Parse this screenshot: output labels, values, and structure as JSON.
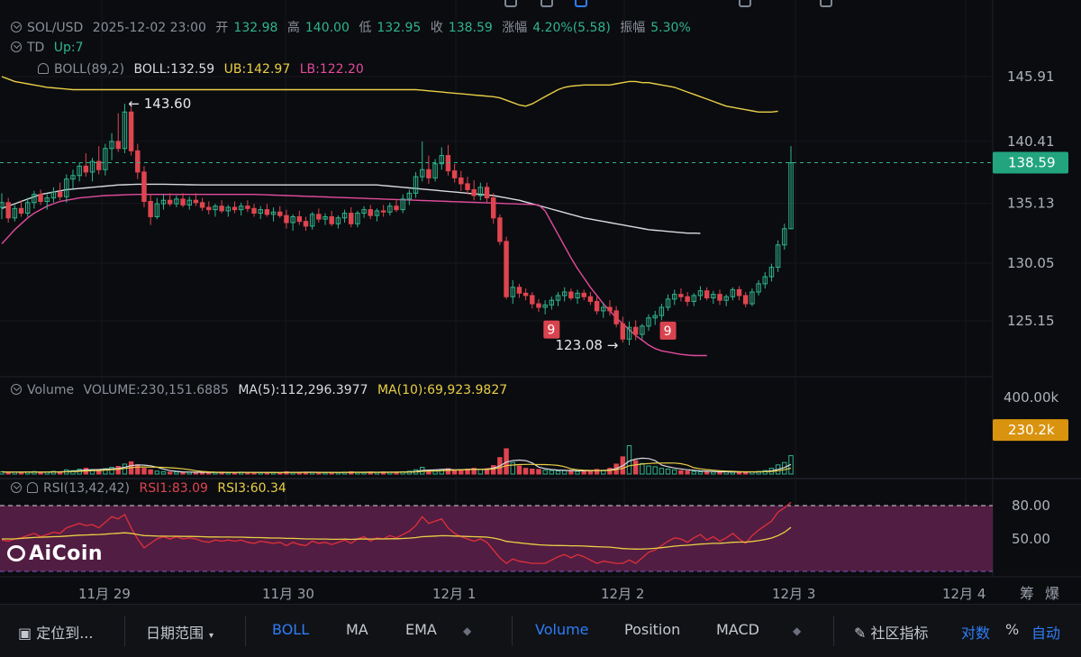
{
  "header": {
    "symbol": "SOL/USD",
    "datetime": "2025-12-02 23:00",
    "open_label": "开",
    "open": "132.98",
    "high_label": "高",
    "high": "140.00",
    "low_label": "低",
    "low": "132.95",
    "close_label": "收",
    "close": "138.59",
    "change_label": "涨幅",
    "change": "4.20%(5.58)",
    "amp_label": "振幅",
    "amp": "5.30%"
  },
  "indicators": {
    "td_label": "TD",
    "td_value": "Up:7",
    "boll_label": "BOLL(89,2)",
    "boll_mid": "BOLL:132.59",
    "boll_ub": "UB:142.97",
    "boll_lb": "LB:122.20",
    "vol_label": "Volume",
    "vol_value": "VOLUME:230,151.6885",
    "vol_ma5": "MA(5):112,296.3977",
    "vol_ma10": "MA(10):69,923.9827",
    "rsi_label": "RSI(13,42,42)",
    "rsi1": "RSI1:83.09",
    "rsi3": "RSI3:60.34"
  },
  "toolbar": {
    "locate": "定位到...",
    "date_range": "日期范围",
    "boll": "BOLL",
    "ma": "MA",
    "ema": "EMA",
    "volume": "Volume",
    "position": "Position",
    "macd": "MACD",
    "community": "社区指标",
    "log": "对数",
    "percent": "%",
    "auto": "自动"
  },
  "logo": "AiCoin",
  "colors": {
    "up": "#2fb58d",
    "down": "#e0454f",
    "mid": "#d7dbe0",
    "ub": "#e8cf46",
    "lb": "#e24c9c",
    "accent": "#2f7df6"
  },
  "chart_data": {
    "type": "candlestick",
    "price_axis_ticks": [
      145.91,
      140.41,
      135.13,
      130.05,
      125.15
    ],
    "current_price": 138.59,
    "volume_axis_ticks": [
      "400.00k"
    ],
    "volume_current": "230.2k",
    "rsi_axis_ticks": [
      80.0,
      50.0
    ],
    "x_ticks": [
      "11月 29",
      "11月 30",
      "12月 1",
      "12月 2",
      "12月 3",
      "12月 4"
    ],
    "x_extra": [
      "筹",
      "爆"
    ],
    "annotations": {
      "high": "143.60",
      "low": "123.08",
      "td_marks": [
        "9",
        "9"
      ]
    },
    "ohlc": [
      [
        134.8,
        136.0,
        133.8,
        135.2
      ],
      [
        135.2,
        135.6,
        133.5,
        133.9
      ],
      [
        133.9,
        135.0,
        133.6,
        134.7
      ],
      [
        134.7,
        135.4,
        134.0,
        134.3
      ],
      [
        134.3,
        135.6,
        134.0,
        135.2
      ],
      [
        135.2,
        136.2,
        134.7,
        135.9
      ],
      [
        135.9,
        136.3,
        135.0,
        135.3
      ],
      [
        135.3,
        135.9,
        134.6,
        135.6
      ],
      [
        135.6,
        136.5,
        135.2,
        136.1
      ],
      [
        136.1,
        136.9,
        135.4,
        135.7
      ],
      [
        135.7,
        137.6,
        135.2,
        137.2
      ],
      [
        137.2,
        138.0,
        136.4,
        137.5
      ],
      [
        137.5,
        138.6,
        137.0,
        138.3
      ],
      [
        138.3,
        139.4,
        137.4,
        137.8
      ],
      [
        137.8,
        139.0,
        137.0,
        138.7
      ],
      [
        138.7,
        140.0,
        137.6,
        138.0
      ],
      [
        138.0,
        140.2,
        137.5,
        139.8
      ],
      [
        139.8,
        141.1,
        138.8,
        140.4
      ],
      [
        140.4,
        142.8,
        139.5,
        139.8
      ],
      [
        139.8,
        143.6,
        139.4,
        142.9
      ],
      [
        142.9,
        143.3,
        139.2,
        139.6
      ],
      [
        139.6,
        140.2,
        137.2,
        137.8
      ],
      [
        137.8,
        138.3,
        134.8,
        135.3
      ],
      [
        135.3,
        135.9,
        133.3,
        134.0
      ],
      [
        134.0,
        135.6,
        133.8,
        135.1
      ],
      [
        135.1,
        135.9,
        134.6,
        135.4
      ],
      [
        135.4,
        136.0,
        134.9,
        135.1
      ],
      [
        135.1,
        135.8,
        134.8,
        135.5
      ],
      [
        135.5,
        136.0,
        134.8,
        135.0
      ],
      [
        135.0,
        135.7,
        134.6,
        135.4
      ],
      [
        135.4,
        136.0,
        134.9,
        135.2
      ],
      [
        135.2,
        135.6,
        134.5,
        134.8
      ],
      [
        134.8,
        135.3,
        134.2,
        134.6
      ],
      [
        134.6,
        135.1,
        134.0,
        134.9
      ],
      [
        134.9,
        135.4,
        134.3,
        134.5
      ],
      [
        134.5,
        135.0,
        134.0,
        134.8
      ],
      [
        134.8,
        135.3,
        134.3,
        134.6
      ],
      [
        134.6,
        135.2,
        134.1,
        134.9
      ],
      [
        134.9,
        135.4,
        134.4,
        134.7
      ],
      [
        134.7,
        135.1,
        134.0,
        134.3
      ],
      [
        134.3,
        134.9,
        133.8,
        134.6
      ],
      [
        134.6,
        135.1,
        134.0,
        134.2
      ],
      [
        134.2,
        134.8,
        133.6,
        134.4
      ],
      [
        134.4,
        134.9,
        133.9,
        134.1
      ],
      [
        134.1,
        134.6,
        133.0,
        133.5
      ],
      [
        133.5,
        134.2,
        132.8,
        134.0
      ],
      [
        134.0,
        134.5,
        133.3,
        133.6
      ],
      [
        133.6,
        134.0,
        132.8,
        133.2
      ],
      [
        133.2,
        134.4,
        132.9,
        134.2
      ],
      [
        134.2,
        134.7,
        133.5,
        133.8
      ],
      [
        133.8,
        134.3,
        133.3,
        134.0
      ],
      [
        134.0,
        134.5,
        133.2,
        133.4
      ],
      [
        133.4,
        134.1,
        133.0,
        133.9
      ],
      [
        133.9,
        134.6,
        133.5,
        134.3
      ],
      [
        134.3,
        134.8,
        133.1,
        133.4
      ],
      [
        133.4,
        134.5,
        133.1,
        134.3
      ],
      [
        134.3,
        134.9,
        133.9,
        134.6
      ],
      [
        134.6,
        135.0,
        133.8,
        134.1
      ],
      [
        134.1,
        134.7,
        133.6,
        134.5
      ],
      [
        134.5,
        135.0,
        134.0,
        134.4
      ],
      [
        134.4,
        135.2,
        134.1,
        134.9
      ],
      [
        134.9,
        135.4,
        134.4,
        134.6
      ],
      [
        134.6,
        135.9,
        134.3,
        135.5
      ],
      [
        135.5,
        136.3,
        135.0,
        136.0
      ],
      [
        136.0,
        137.8,
        135.6,
        137.4
      ],
      [
        137.4,
        140.4,
        137.0,
        138.0
      ],
      [
        138.0,
        139.2,
        136.8,
        137.3
      ],
      [
        137.3,
        138.9,
        137.0,
        138.5
      ],
      [
        138.5,
        139.9,
        138.0,
        139.2
      ],
      [
        139.2,
        140.1,
        137.5,
        137.9
      ],
      [
        137.9,
        138.5,
        136.9,
        137.3
      ],
      [
        137.3,
        137.9,
        136.2,
        136.8
      ],
      [
        136.8,
        137.4,
        135.9,
        136.3
      ],
      [
        136.3,
        137.1,
        135.4,
        135.8
      ],
      [
        135.8,
        136.9,
        135.4,
        136.5
      ],
      [
        136.5,
        136.9,
        135.2,
        135.6
      ],
      [
        135.6,
        136.0,
        133.4,
        133.9
      ],
      [
        133.9,
        134.2,
        131.6,
        131.9
      ],
      [
        131.9,
        132.3,
        127.0,
        127.2
      ],
      [
        127.2,
        128.6,
        126.6,
        128.0
      ],
      [
        128.0,
        128.3,
        127.1,
        127.5
      ],
      [
        127.5,
        127.9,
        126.9,
        127.3
      ],
      [
        127.3,
        127.6,
        126.2,
        126.6
      ],
      [
        126.6,
        127.0,
        125.9,
        126.3
      ],
      [
        126.3,
        126.9,
        125.7,
        126.5
      ],
      [
        126.5,
        127.2,
        126.1,
        126.9
      ],
      [
        126.9,
        127.6,
        126.4,
        127.3
      ],
      [
        127.3,
        128.0,
        126.8,
        127.6
      ],
      [
        127.6,
        127.9,
        126.9,
        127.1
      ],
      [
        127.1,
        127.8,
        126.6,
        127.5
      ],
      [
        127.5,
        127.8,
        126.9,
        127.2
      ],
      [
        127.2,
        127.6,
        126.5,
        126.8
      ],
      [
        126.8,
        127.2,
        125.7,
        126.0
      ],
      [
        126.0,
        126.7,
        125.4,
        126.3
      ],
      [
        126.3,
        126.9,
        125.6,
        126.0
      ],
      [
        126.0,
        126.4,
        124.6,
        124.9
      ],
      [
        124.9,
        125.5,
        123.3,
        123.6
      ],
      [
        123.6,
        125.1,
        123.08,
        124.6
      ],
      [
        124.6,
        125.2,
        123.5,
        124.0
      ],
      [
        124.0,
        124.9,
        123.6,
        124.7
      ],
      [
        124.7,
        125.7,
        124.3,
        125.4
      ],
      [
        125.4,
        126.0,
        124.8,
        125.6
      ],
      [
        125.6,
        126.6,
        125.2,
        126.3
      ],
      [
        126.3,
        127.4,
        126.0,
        127.0
      ],
      [
        127.0,
        127.8,
        126.5,
        127.4
      ],
      [
        127.4,
        127.9,
        126.8,
        127.2
      ],
      [
        127.2,
        127.6,
        126.4,
        126.8
      ],
      [
        126.8,
        127.5,
        126.4,
        127.3
      ],
      [
        127.3,
        128.1,
        126.9,
        127.7
      ],
      [
        127.7,
        128.0,
        126.9,
        127.1
      ],
      [
        127.1,
        127.7,
        126.6,
        127.4
      ],
      [
        127.4,
        127.8,
        126.5,
        126.9
      ],
      [
        126.9,
        127.4,
        126.4,
        127.2
      ],
      [
        127.2,
        128.0,
        126.9,
        127.8
      ],
      [
        127.8,
        128.1,
        126.9,
        127.3
      ],
      [
        127.3,
        127.6,
        126.3,
        126.6
      ],
      [
        126.6,
        127.9,
        126.4,
        127.6
      ],
      [
        127.6,
        128.6,
        127.3,
        128.3
      ],
      [
        128.3,
        129.3,
        127.9,
        128.9
      ],
      [
        128.9,
        130.0,
        128.5,
        129.7
      ],
      [
        129.7,
        132.0,
        129.3,
        131.6
      ],
      [
        131.6,
        133.4,
        131.2,
        132.98
      ],
      [
        132.98,
        140.0,
        132.95,
        138.59
      ]
    ],
    "volume": [
      12,
      9,
      10,
      8,
      11,
      13,
      9,
      10,
      14,
      12,
      22,
      18,
      25,
      30,
      20,
      24,
      28,
      35,
      40,
      52,
      64,
      48,
      30,
      22,
      15,
      12,
      10,
      11,
      9,
      10,
      8,
      9,
      7,
      8,
      9,
      7,
      8,
      10,
      9,
      8,
      7,
      8,
      9,
      7,
      12,
      9,
      8,
      10,
      9,
      8,
      7,
      9,
      8,
      10,
      12,
      9,
      8,
      10,
      9,
      11,
      10,
      9,
      12,
      15,
      22,
      35,
      20,
      18,
      24,
      28,
      20,
      22,
      26,
      30,
      24,
      28,
      44,
      86,
      132,
      60,
      42,
      30,
      26,
      24,
      20,
      18,
      16,
      18,
      20,
      14,
      16,
      18,
      24,
      20,
      30,
      52,
      90,
      148,
      70,
      55,
      42,
      38,
      30,
      26,
      22,
      18,
      16,
      14,
      12,
      14,
      11,
      10,
      12,
      10,
      11,
      10,
      12,
      14,
      18,
      30,
      48,
      60,
      96
    ],
    "boll_ub": [
      145.91,
      145.7,
      145.5,
      145.4,
      145.3,
      145.2,
      145.1,
      145.0,
      144.95,
      144.9,
      144.85,
      144.8,
      144.8,
      144.8,
      144.8,
      144.8,
      144.8,
      144.8,
      144.8,
      144.8,
      144.8,
      144.8,
      144.8,
      144.8,
      144.8,
      144.8,
      144.8,
      144.8,
      144.8,
      144.8,
      144.8,
      144.8,
      144.8,
      144.8,
      144.8,
      144.8,
      144.8,
      144.8,
      144.8,
      144.8,
      144.8,
      144.8,
      144.8,
      144.8,
      144.8,
      144.8,
      144.8,
      144.8,
      144.8,
      144.8,
      144.8,
      144.8,
      144.8,
      144.8,
      144.8,
      144.8,
      144.8,
      144.8,
      144.8,
      144.8,
      144.8,
      144.8,
      144.8,
      144.8,
      144.8,
      144.75,
      144.7,
      144.65,
      144.6,
      144.55,
      144.5,
      144.45,
      144.4,
      144.35,
      144.3,
      144.25,
      144.2,
      144.1,
      143.9,
      143.7,
      143.5,
      143.4,
      143.6,
      143.9,
      144.2,
      144.5,
      144.8,
      145.0,
      145.1,
      145.15,
      145.2,
      145.2,
      145.2,
      145.2,
      145.2,
      145.3,
      145.4,
      145.5,
      145.5,
      145.4,
      145.4,
      145.3,
      145.2,
      145.1,
      145.0,
      144.8,
      144.6,
      144.4,
      144.2,
      144.0,
      143.8,
      143.6,
      143.4,
      143.3,
      143.2,
      143.1,
      143.0,
      142.9,
      142.9,
      142.9,
      142.97
    ],
    "boll_mid": [
      134.7,
      134.9,
      135.1,
      135.3,
      135.5,
      135.7,
      135.9,
      136.0,
      136.1,
      136.2,
      136.3,
      136.35,
      136.4,
      136.45,
      136.5,
      136.55,
      136.6,
      136.65,
      136.7,
      136.72,
      136.74,
      136.76,
      136.76,
      136.76,
      136.76,
      136.76,
      136.75,
      136.74,
      136.73,
      136.72,
      136.71,
      136.7,
      136.7,
      136.7,
      136.7,
      136.7,
      136.7,
      136.7,
      136.7,
      136.7,
      136.7,
      136.7,
      136.7,
      136.7,
      136.7,
      136.7,
      136.7,
      136.7,
      136.7,
      136.7,
      136.7,
      136.7,
      136.7,
      136.7,
      136.7,
      136.7,
      136.7,
      136.7,
      136.7,
      136.65,
      136.6,
      136.55,
      136.5,
      136.45,
      136.4,
      136.35,
      136.3,
      136.25,
      136.2,
      136.15,
      136.1,
      136.05,
      136.0,
      135.95,
      135.9,
      135.85,
      135.8,
      135.7,
      135.6,
      135.5,
      135.4,
      135.25,
      135.1,
      134.95,
      134.8,
      134.65,
      134.5,
      134.35,
      134.2,
      134.05,
      133.9,
      133.8,
      133.7,
      133.6,
      133.5,
      133.4,
      133.3,
      133.2,
      133.1,
      133.0,
      132.9,
      132.85,
      132.8,
      132.75,
      132.7,
      132.65,
      132.6,
      132.6,
      132.59
    ],
    "boll_lb": [
      131.7,
      132.3,
      132.9,
      133.4,
      133.9,
      134.3,
      134.6,
      134.9,
      135.1,
      135.3,
      135.4,
      135.5,
      135.6,
      135.65,
      135.7,
      135.75,
      135.8,
      135.82,
      135.84,
      135.86,
      135.88,
      135.9,
      135.9,
      135.9,
      135.9,
      135.9,
      135.9,
      135.9,
      135.9,
      135.9,
      135.9,
      135.9,
      135.9,
      135.9,
      135.9,
      135.9,
      135.9,
      135.9,
      135.9,
      135.9,
      135.88,
      135.86,
      135.84,
      135.82,
      135.8,
      135.78,
      135.76,
      135.74,
      135.72,
      135.7,
      135.68,
      135.66,
      135.64,
      135.62,
      135.6,
      135.58,
      135.56,
      135.54,
      135.52,
      135.5,
      135.48,
      135.46,
      135.44,
      135.42,
      135.4,
      135.38,
      135.36,
      135.34,
      135.32,
      135.3,
      135.28,
      135.26,
      135.24,
      135.22,
      135.2,
      135.18,
      135.16,
      135.14,
      135.12,
      135.1,
      135.08,
      135.06,
      135.04,
      135.0,
      134.5,
      133.5,
      132.5,
      131.5,
      130.5,
      129.6,
      128.8,
      128.0,
      127.3,
      126.6,
      126.0,
      125.4,
      124.9,
      124.4,
      123.9,
      123.5,
      123.1,
      122.8,
      122.6,
      122.5,
      122.4,
      122.3,
      122.25,
      122.2,
      122.2,
      122.2
    ],
    "rsi1": [
      49,
      48,
      50,
      51,
      53,
      55,
      52,
      54,
      56,
      55,
      60,
      62,
      64,
      62,
      63,
      60,
      65,
      70,
      68,
      72,
      60,
      50,
      42,
      46,
      50,
      52,
      50,
      52,
      50,
      51,
      50,
      48,
      47,
      49,
      48,
      49,
      48,
      49,
      47,
      46,
      48,
      47,
      46,
      47,
      44,
      47,
      45,
      44,
      48,
      46,
      47,
      45,
      47,
      49,
      46,
      50,
      52,
      48,
      51,
      50,
      53,
      51,
      54,
      57,
      62,
      70,
      64,
      66,
      68,
      60,
      55,
      52,
      50,
      48,
      50,
      47,
      40,
      33,
      24,
      32,
      30,
      29,
      27,
      26,
      28,
      31,
      34,
      36,
      33,
      36,
      34,
      31,
      28,
      30,
      29,
      24,
      20,
      31,
      28,
      33,
      38,
      40,
      44,
      48,
      51,
      50,
      47,
      51,
      54,
      49,
      52,
      48,
      51,
      55,
      50,
      46,
      53,
      58,
      62,
      66,
      74,
      78,
      83.09
    ],
    "rsi3": [
      50,
      50,
      50,
      50.5,
      51,
      51.3,
      51.5,
      51.8,
      52,
      52.2,
      52.6,
      53,
      53.4,
      53.6,
      53.8,
      54,
      54.3,
      54.8,
      55.1,
      55.5,
      55,
      54,
      53,
      52.8,
      52.6,
      52.5,
      52.4,
      52.4,
      52.3,
      52.3,
      52.2,
      52,
      51.8,
      51.8,
      51.7,
      51.7,
      51.6,
      51.6,
      51.4,
      51.2,
      51.2,
      51,
      50.8,
      50.8,
      50.5,
      50.5,
      50.3,
      50,
      50,
      49.9,
      49.9,
      49.7,
      49.7,
      49.8,
      49.6,
      49.8,
      50,
      49.9,
      50,
      50,
      50.2,
      50.2,
      50.4,
      50.7,
      51.2,
      52,
      52.3,
      52.6,
      52.9,
      52.8,
      52.6,
      52.4,
      52.2,
      52,
      51.9,
      51.6,
      50.8,
      49.6,
      47.8,
      47.2,
      46.5,
      45.9,
      45.3,
      44.7,
      44.4,
      44.2,
      44.1,
      44,
      43.8,
      43.8,
      43.6,
      43.3,
      43,
      42.8,
      42.6,
      42,
      41.3,
      41.1,
      40.8,
      40.9,
      41.2,
      41.6,
      42.1,
      42.8,
      43.5,
      44,
      44.3,
      44.8,
      45.4,
      45.6,
      46,
      46.1,
      46.4,
      47,
      47.2,
      47.2,
      47.7,
      48.5,
      49.5,
      50.8,
      53,
      56,
      60.34
    ]
  }
}
